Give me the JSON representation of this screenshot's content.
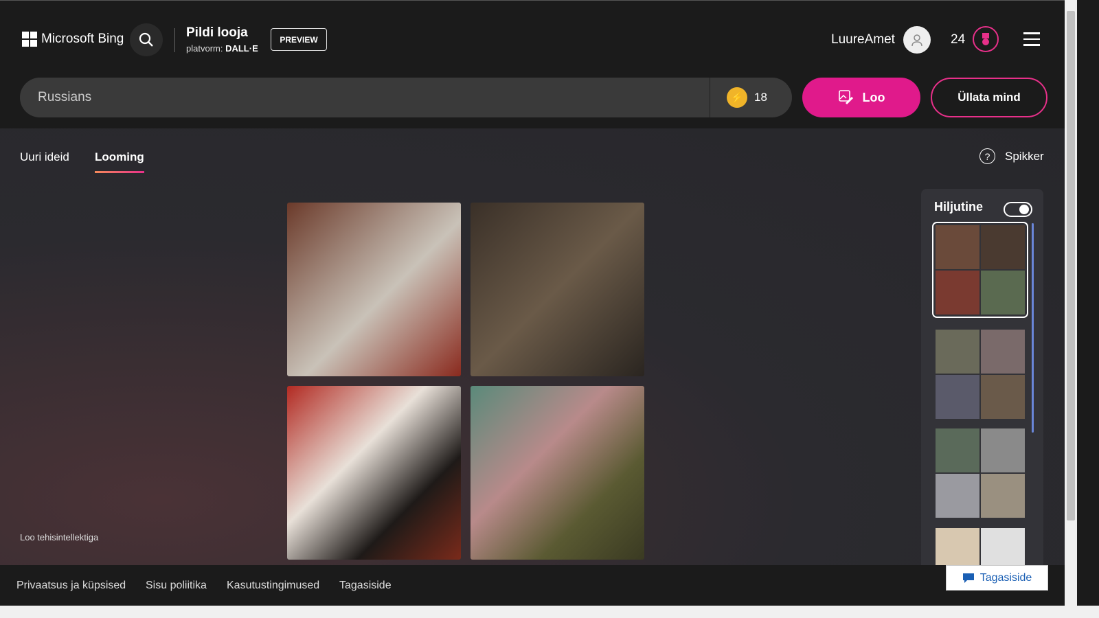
{
  "header": {
    "brand": "Microsoft Bing",
    "title": "Pildi looja",
    "platform_label": "platvorm:",
    "platform": "DALL·E",
    "preview": "PREVIEW",
    "username": "LuureAmet",
    "rewards": "24"
  },
  "search": {
    "value": "Russians",
    "boosts": "18",
    "create": "Loo",
    "surprise": "Üllata mind"
  },
  "tabs": [
    {
      "label": "Uuri ideid"
    },
    {
      "label": "Looming"
    }
  ],
  "help": "Spikker",
  "ai_note": "Loo tehisintellektiga",
  "recent": {
    "title": "Hiljutine",
    "toggle_on": true
  },
  "footer": {
    "links": [
      "Privaatsus ja küpsised",
      "Sisu poliitika",
      "Kasutustingimused",
      "Tagasiside"
    ],
    "feedback": "Tagasiside"
  },
  "colors": {
    "accent": "#e01a8b",
    "bg": "#1b1b1b"
  }
}
